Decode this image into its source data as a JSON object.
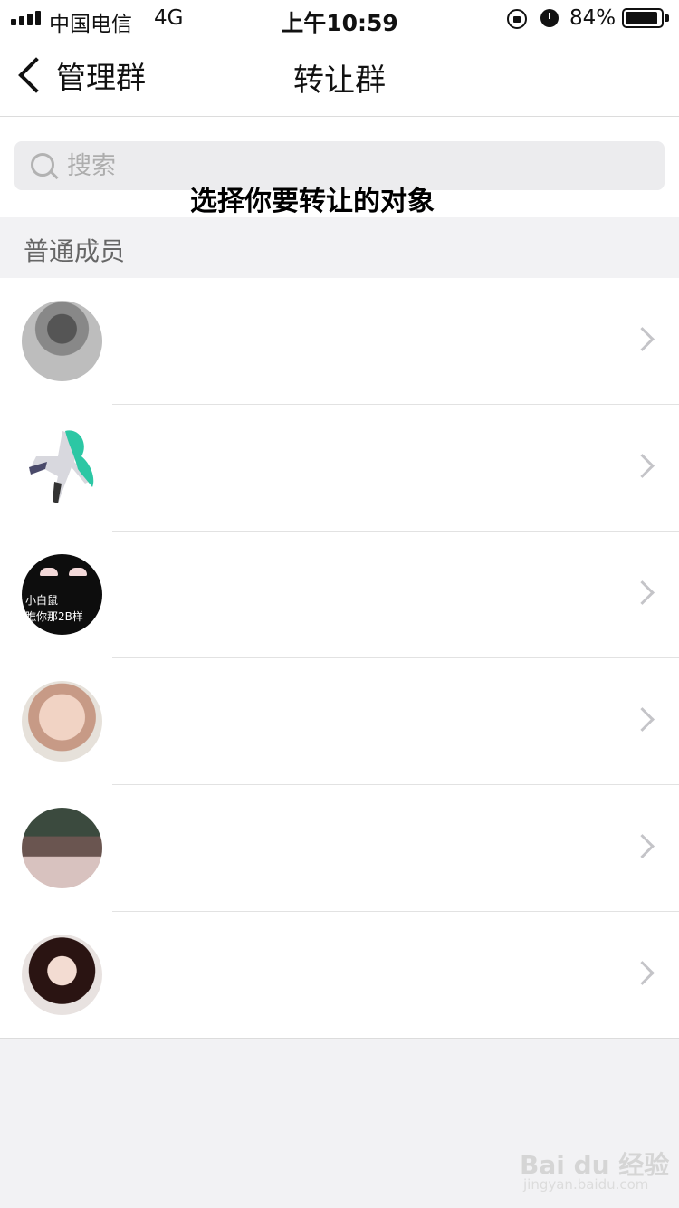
{
  "status_bar": {
    "carrier": "中国电信",
    "network": "4G",
    "time": "上午10:59",
    "battery_percent": "84%",
    "battery_level": 0.84,
    "icons": [
      "signal-icon",
      "orientation-lock-icon",
      "alarm-icon",
      "battery-icon"
    ]
  },
  "nav": {
    "back_label": "管理群",
    "title": "转让群"
  },
  "search": {
    "placeholder": "搜索"
  },
  "caption": "选择你要转让的对象",
  "section": {
    "title": "普通成员"
  },
  "members": [
    {
      "avatar": "avatar-photo-man"
    },
    {
      "avatar": "avatar-anime-green-hair"
    },
    {
      "avatar": "avatar-dark-text",
      "avatar_text": [
        "小白鼠",
        "瞧你那2B样"
      ]
    },
    {
      "avatar": "avatar-photo-child"
    },
    {
      "avatar": "avatar-photo-group"
    },
    {
      "avatar": "avatar-anime-girl"
    }
  ],
  "watermark": {
    "main": "Bai du 经验",
    "sub": "jingyan.baidu.com"
  }
}
